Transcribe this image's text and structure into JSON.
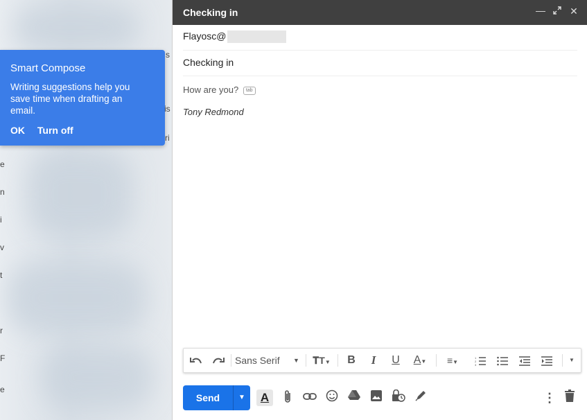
{
  "smart_compose": {
    "title": "Smart Compose",
    "body": "Writing suggestions help you save time when drafting an email.",
    "ok_label": "OK",
    "turnoff_label": "Turn off"
  },
  "compose": {
    "title": "Checking in",
    "to_value": "Flayosc@",
    "subject": "Checking in",
    "body_text": "How are you?",
    "tab_hint": "tab",
    "signature": "Tony Redmond"
  },
  "toolbar": {
    "font": "Sans Serif",
    "send_label": "Send"
  },
  "bg_fragments": [
    "s",
    "is",
    "ri",
    "e",
    "n",
    "i",
    "v",
    "t",
    "r",
    "e",
    "F"
  ],
  "colors": {
    "header": "#404040",
    "accent": "#1a73e8",
    "popup": "#3b7de8"
  }
}
